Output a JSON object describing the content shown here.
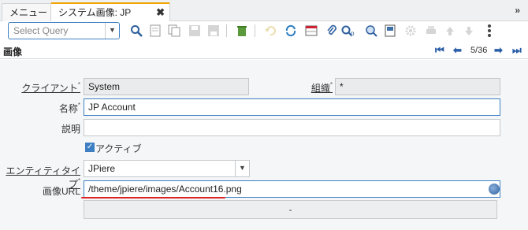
{
  "tabs": [
    {
      "label": "メニュー"
    },
    {
      "label": "システム画像: JP Account",
      "close": "✖"
    }
  ],
  "toolbar": {
    "query_placeholder": "Select Query",
    "icons": [
      "search-icon",
      "new-record-icon",
      "copy-record-icon",
      "save-icon",
      "save-new-icon",
      "delete-icon",
      "undo-icon",
      "refresh-icon",
      "grid-toggle-icon",
      "attachment-icon",
      "zoom-across-icon",
      "report-icon",
      "settings-icon",
      "print-icon",
      "up-icon",
      "down-icon",
      "more-icon"
    ]
  },
  "status": {
    "title": "画像",
    "record": "5/36"
  },
  "form": {
    "client_label": "クライアント",
    "client_value": "System",
    "org_label": "組織",
    "org_value": "*",
    "name_label": "名称",
    "name_value": "JP Account",
    "description_label": "説明",
    "description_value": "",
    "active_label": "アクティブ",
    "entity_label": "エンティティタイプ",
    "entity_value": "JPiere",
    "url_label": "画像URL",
    "url_value": "/theme/jpiere/images/Account16.png",
    "binary_button": "-"
  },
  "colors": {
    "accent": "#3d7fc2",
    "tab_active": "#f0a500",
    "annotation": "#dd2222"
  }
}
